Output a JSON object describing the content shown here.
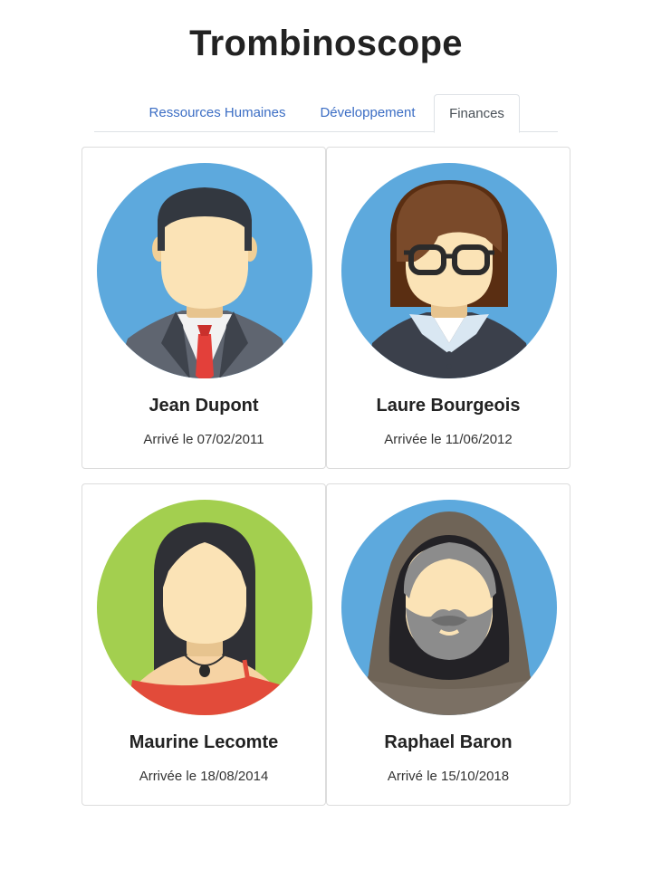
{
  "header": {
    "title": "Trombinoscope"
  },
  "tabs": [
    {
      "label": "Ressources Humaines",
      "active": false
    },
    {
      "label": "Développement",
      "active": false
    },
    {
      "label": "Finances",
      "active": true
    }
  ],
  "people": [
    {
      "name": "Jean Dupont",
      "arrival": "Arrivé le 07/02/2011",
      "avatar": "man-suit-icon",
      "bg": "#5da9dd"
    },
    {
      "name": "Laure Bourgeois",
      "arrival": "Arrivée le 11/06/2012",
      "avatar": "woman-glasses-icon",
      "bg": "#5da9dd"
    },
    {
      "name": "Maurine Lecomte",
      "arrival": "Arrivée le 18/08/2014",
      "avatar": "woman-long-hair-icon",
      "bg": "#a3cf4f"
    },
    {
      "name": "Raphael Baron",
      "arrival": "Arrivé le 15/10/2018",
      "avatar": "hooded-bearded-man-icon",
      "bg": "#5da9dd"
    }
  ],
  "colors": {
    "accent": "#3b6dc4",
    "border": "#dee2e6",
    "skin": "#fbe3b6"
  }
}
